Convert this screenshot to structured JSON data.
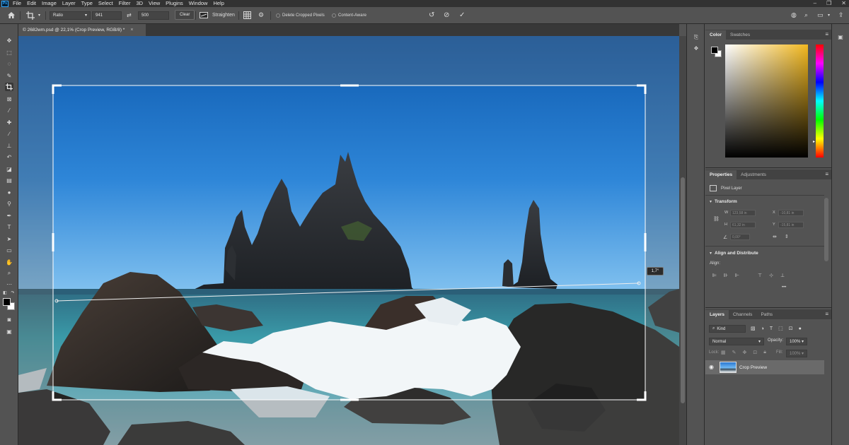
{
  "app": {
    "logo": "Ps",
    "menu": [
      "File",
      "Edit",
      "Image",
      "Layer",
      "Type",
      "Select",
      "Filter",
      "3D",
      "View",
      "Plugins",
      "Window",
      "Help"
    ]
  },
  "options": {
    "ratio_select": "Ratio",
    "width_value": "941",
    "height_value": "500",
    "clear_label": "Clear",
    "straighten_label": "Straighten",
    "delete_cropped_label": "Delete Cropped Pixels",
    "content_aware_label": "Content-Aware"
  },
  "document": {
    "tab_title": "© 2682wm.psd @ 22,1% (Crop Preview, RGB/8) *",
    "close_glyph": "×",
    "straighten_angle": "1,7°"
  },
  "color_panel": {
    "tabs": [
      "Color",
      "Swatches"
    ],
    "colors": {
      "foreground": "#000000",
      "background": "#ffffff",
      "hue": "#f2b81f"
    }
  },
  "properties_panel": {
    "tabs": [
      "Properties",
      "Adjustments"
    ],
    "layer_type": "Pixel Layer",
    "transform_label": "Transform",
    "w_label": "W",
    "w_value": "123,58 in",
    "x_label": "X",
    "x_value": "-10,81 in",
    "h_label": "H",
    "h_value": "61,32 in",
    "y_label": "Y",
    "y_value": "-15,81 in",
    "angle_value": "0,00°",
    "align_section": "Align and Distribute",
    "align_label": "Align:",
    "more_glyph": "•••"
  },
  "layers_panel": {
    "tabs": [
      "Layers",
      "Channels",
      "Paths"
    ],
    "kind_label": "Kind",
    "blend_mode": "Normal",
    "opacity_label": "Opacity:",
    "opacity_value": "100%",
    "lock_label": "Lock:",
    "fill_label": "Fill:",
    "fill_value": "100%",
    "layer_name": "Crop Preview"
  }
}
